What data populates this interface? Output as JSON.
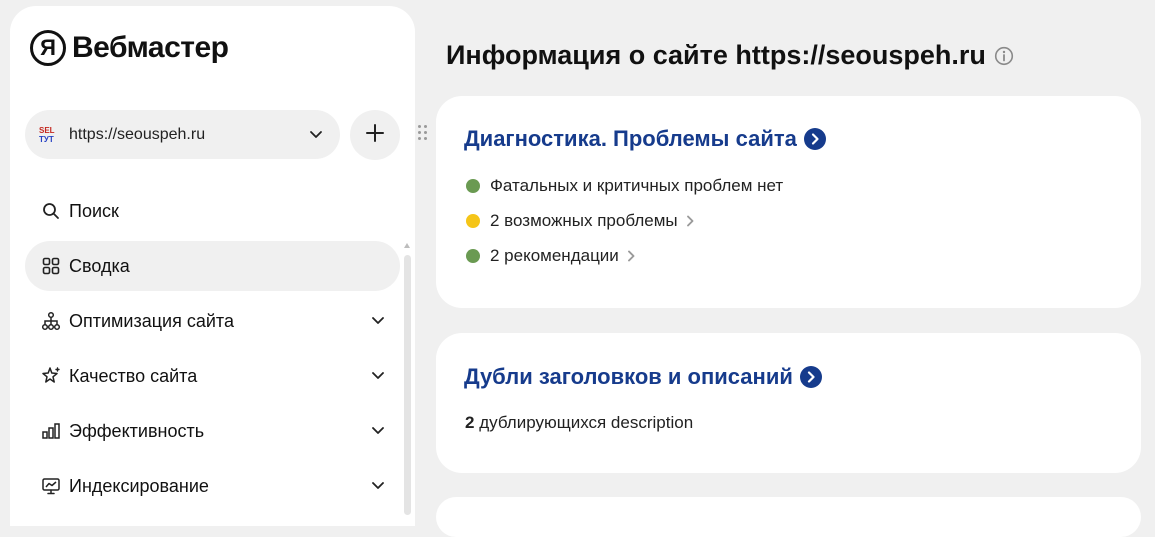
{
  "app": {
    "logo_letter": "Я",
    "logo_text": "Вебмастер"
  },
  "site_selector": {
    "favicon_top": "SEL",
    "favicon_bottom": "ТУТ",
    "url": "https://seouspeh.ru"
  },
  "nav": {
    "items": [
      {
        "label": "Поиск",
        "icon": "search-icon",
        "active": false,
        "expandable": false
      },
      {
        "label": "Сводка",
        "icon": "dashboard-grid-icon",
        "active": true,
        "expandable": false
      },
      {
        "label": "Оптимизация сайта",
        "icon": "sitemap-icon",
        "active": false,
        "expandable": true
      },
      {
        "label": "Качество сайта",
        "icon": "sparkle-star-icon",
        "active": false,
        "expandable": true
      },
      {
        "label": "Эффективность",
        "icon": "bar-chart-icon",
        "active": false,
        "expandable": true
      },
      {
        "label": "Индексирование",
        "icon": "monitor-chart-icon",
        "active": false,
        "expandable": true
      }
    ]
  },
  "main": {
    "title": "Информация о сайте https://seouspeh.ru",
    "cards": [
      {
        "title": "Диагностика. Проблемы сайта",
        "rows": [
          {
            "text": "Фатальных и критичных проблем нет",
            "status_color": "#6a9a52",
            "has_link": false
          },
          {
            "text": "2 возможных проблемы",
            "status_color": "#f5c518",
            "has_link": true
          },
          {
            "text": "2 рекомендации",
            "status_color": "#6a9a52",
            "has_link": true
          }
        ]
      },
      {
        "title": "Дубли заголовков и описаний",
        "count": "2",
        "count_label": "дублирующихся description"
      }
    ]
  },
  "colors": {
    "accent_link": "#163b8c",
    "background": "#f0f0f0",
    "card": "#ffffff",
    "ok": "#6a9a52",
    "warning": "#f5c518"
  }
}
